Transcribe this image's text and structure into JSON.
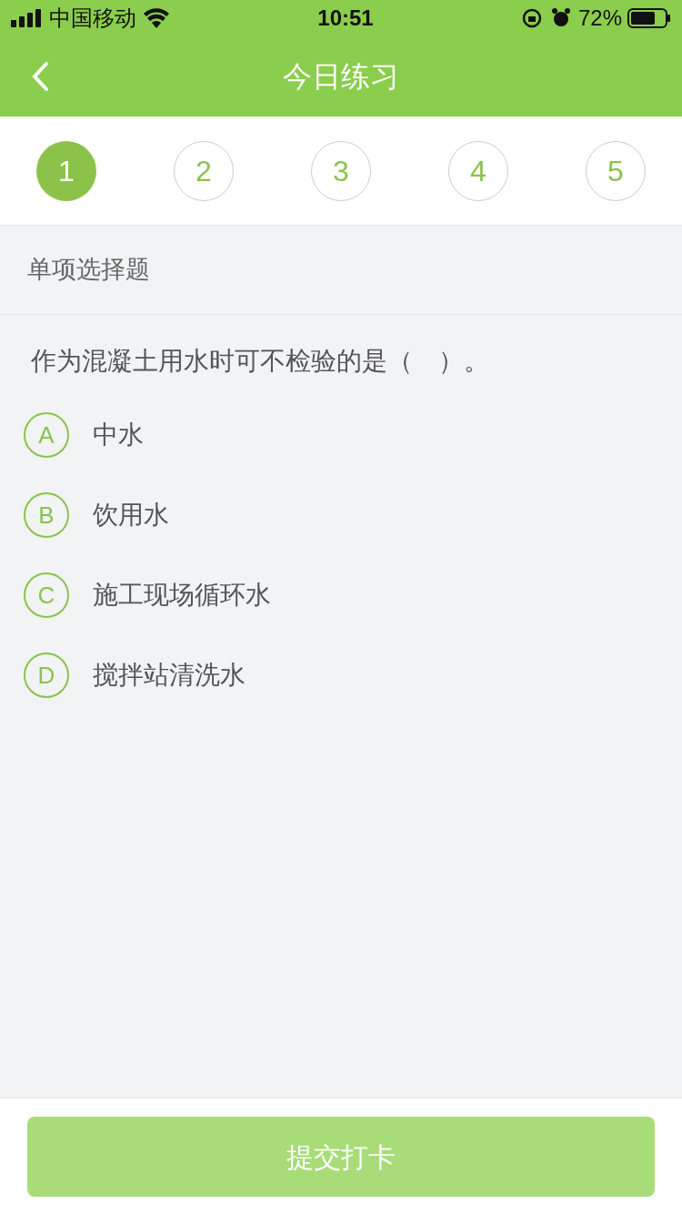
{
  "status_bar": {
    "carrier": "中国移动",
    "time": "10:51",
    "battery": "72%"
  },
  "header": {
    "title": "今日练习"
  },
  "steps": [
    {
      "label": "1",
      "selected": true
    },
    {
      "label": "2",
      "selected": false
    },
    {
      "label": "3",
      "selected": false
    },
    {
      "label": "4",
      "selected": false
    },
    {
      "label": "5",
      "selected": false
    }
  ],
  "section": "单项选择题",
  "question": "作为混凝土用水时可不检验的是（　）。",
  "options": [
    {
      "letter": "A",
      "text": "中水",
      "selected": false
    },
    {
      "letter": "B",
      "text": "饮用水",
      "selected": false
    },
    {
      "letter": "C",
      "text": "施工现场循环水",
      "selected": false
    },
    {
      "letter": "D",
      "text": "搅拌站清洗水",
      "selected": false
    }
  ],
  "submit": {
    "label": "提交打卡",
    "disabled": true
  }
}
